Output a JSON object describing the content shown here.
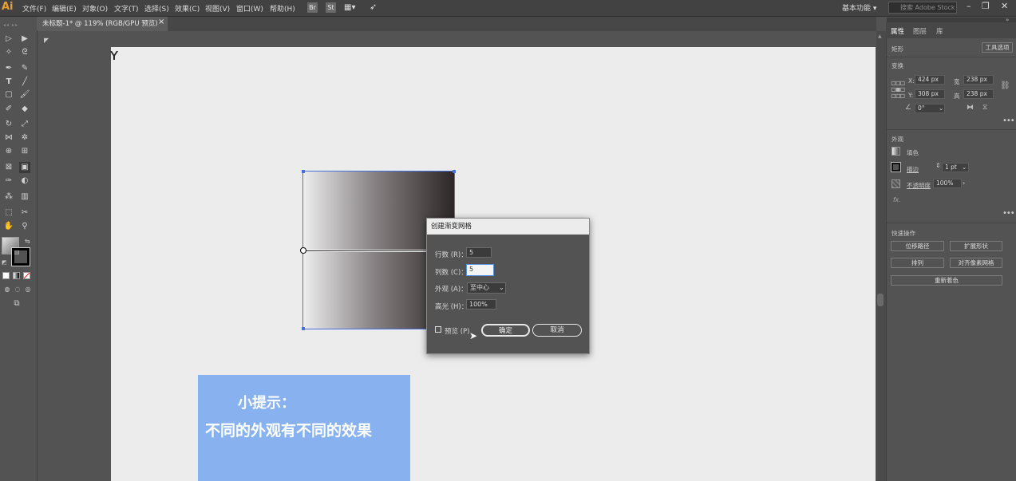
{
  "app": {
    "logo": "Ai"
  },
  "menu": [
    "文件(F)",
    "编辑(E)",
    "对象(O)",
    "文字(T)",
    "选择(S)",
    "效果(C)",
    "视图(V)",
    "窗口(W)",
    "帮助(H)"
  ],
  "menubar_buttons": {
    "bridge": "Br",
    "stock": "St"
  },
  "workspace": "基本功能",
  "stock_search_placeholder": "搜索 Adobe Stock",
  "document_tab": {
    "title": "未标题-1* @ 119% (RGB/GPU 预览)",
    "close": "×"
  },
  "canvas": {
    "hint_title": "小提示：",
    "hint_body": "不同的外观有不同的效果"
  },
  "dialog": {
    "title": "创建渐变网格",
    "rows_label": "行数 (R)：",
    "rows_value": "5",
    "cols_label": "列数 (C)：",
    "cols_value": "5",
    "appearance_label": "外观 (A)：",
    "appearance_value": "至中心",
    "highlight_label": "高光 (H)：",
    "highlight_value": "100%",
    "preview_label": "预览 (P)",
    "ok_label": "确定",
    "cancel_label": "取消"
  },
  "right_panel": {
    "tabs": [
      "属性",
      "图层",
      "库"
    ],
    "shape_label": "矩形",
    "tool_options": "工具选项",
    "transform_label": "变换",
    "x_label": "X:",
    "x_value": "424 px",
    "y_label": "Y:",
    "y_value": "308 px",
    "w_label": "宽",
    "w_value": "238 px",
    "h_label": "高",
    "h_value": "238 px",
    "angle_value": "0°",
    "appearance_label": "外观",
    "fill_label": "填色",
    "stroke_label": "描边",
    "stroke_value": "1 pt",
    "opacity_label": "不透明度",
    "opacity_value": "100%",
    "fx_label": "fx.",
    "quick_actions_label": "快速操作",
    "btn_offset_path": "位移路径",
    "btn_expand_shape": "扩展形状",
    "btn_arrange": "排列",
    "btn_align_pixel": "对齐像素网格",
    "btn_recolor": "重新着色"
  }
}
